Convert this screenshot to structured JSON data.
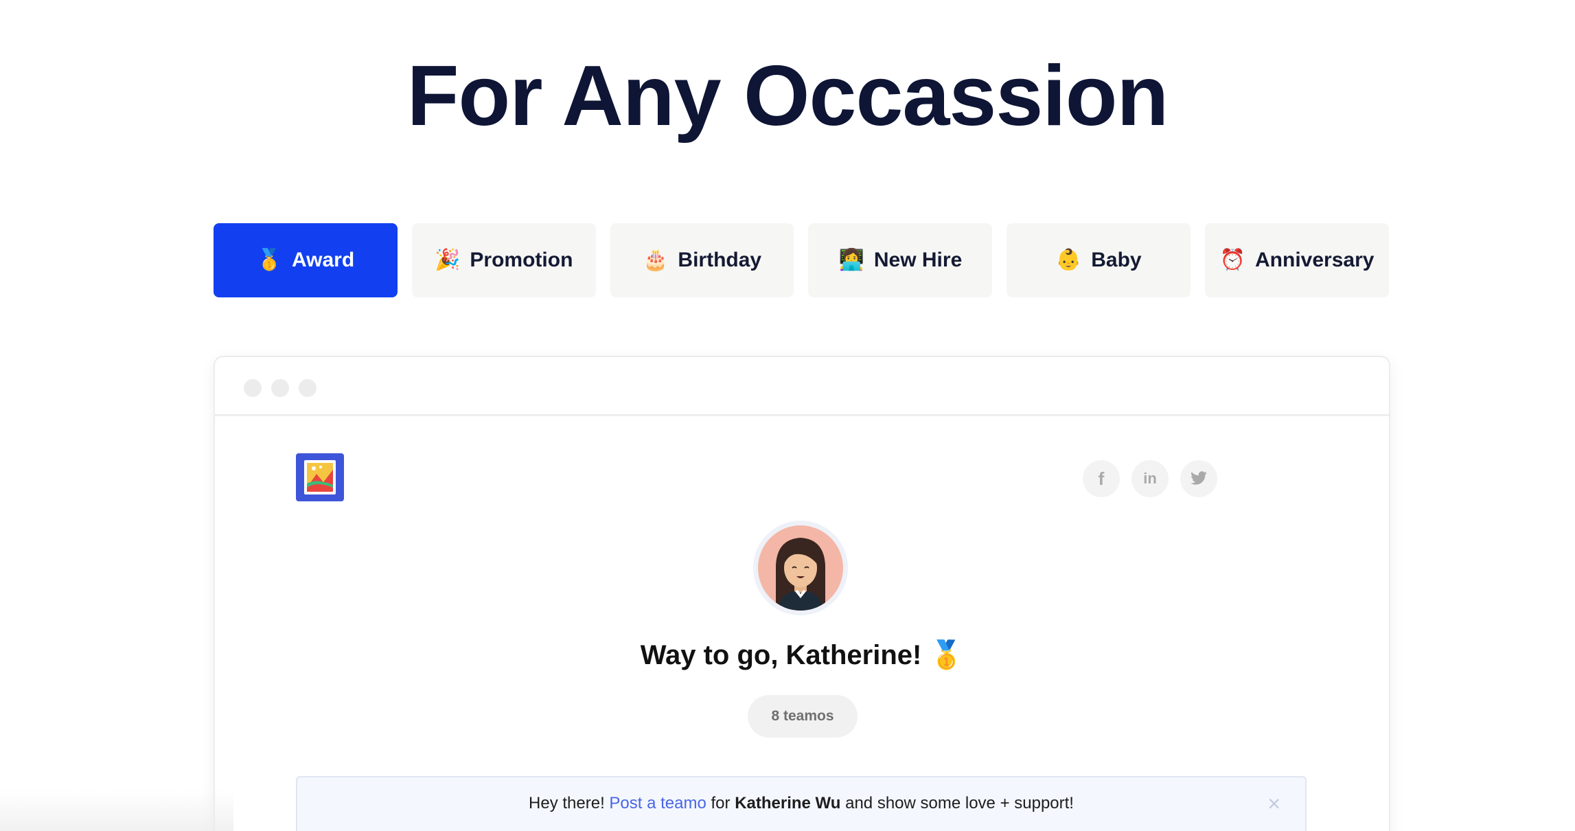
{
  "headline": "For Any Occassion",
  "tabs": [
    {
      "label": "Award",
      "emoji": "🥇",
      "active": true
    },
    {
      "label": "Promotion",
      "emoji": "🎉",
      "active": false
    },
    {
      "label": "Birthday",
      "emoji": "🎂",
      "active": false
    },
    {
      "label": "New Hire",
      "emoji": "👩‍💻",
      "active": false
    },
    {
      "label": "Baby",
      "emoji": "👶",
      "active": false
    },
    {
      "label": "Anniversary",
      "emoji": "⏰",
      "active": false
    }
  ],
  "card": {
    "social": {
      "facebook": "f",
      "linkedin": "in"
    },
    "greeting": "Way to go, Katherine! 🥇",
    "count": "8 teamos",
    "banner": {
      "prefix": "Hey there!",
      "link": "Post a teamo",
      "middle": "for",
      "name": "Katherine Wu",
      "suffix": "and show some love + support!",
      "close": "×"
    }
  },
  "colors": {
    "accent": "#1240f0",
    "headline": "#0e1535",
    "link": "#4966e6"
  }
}
